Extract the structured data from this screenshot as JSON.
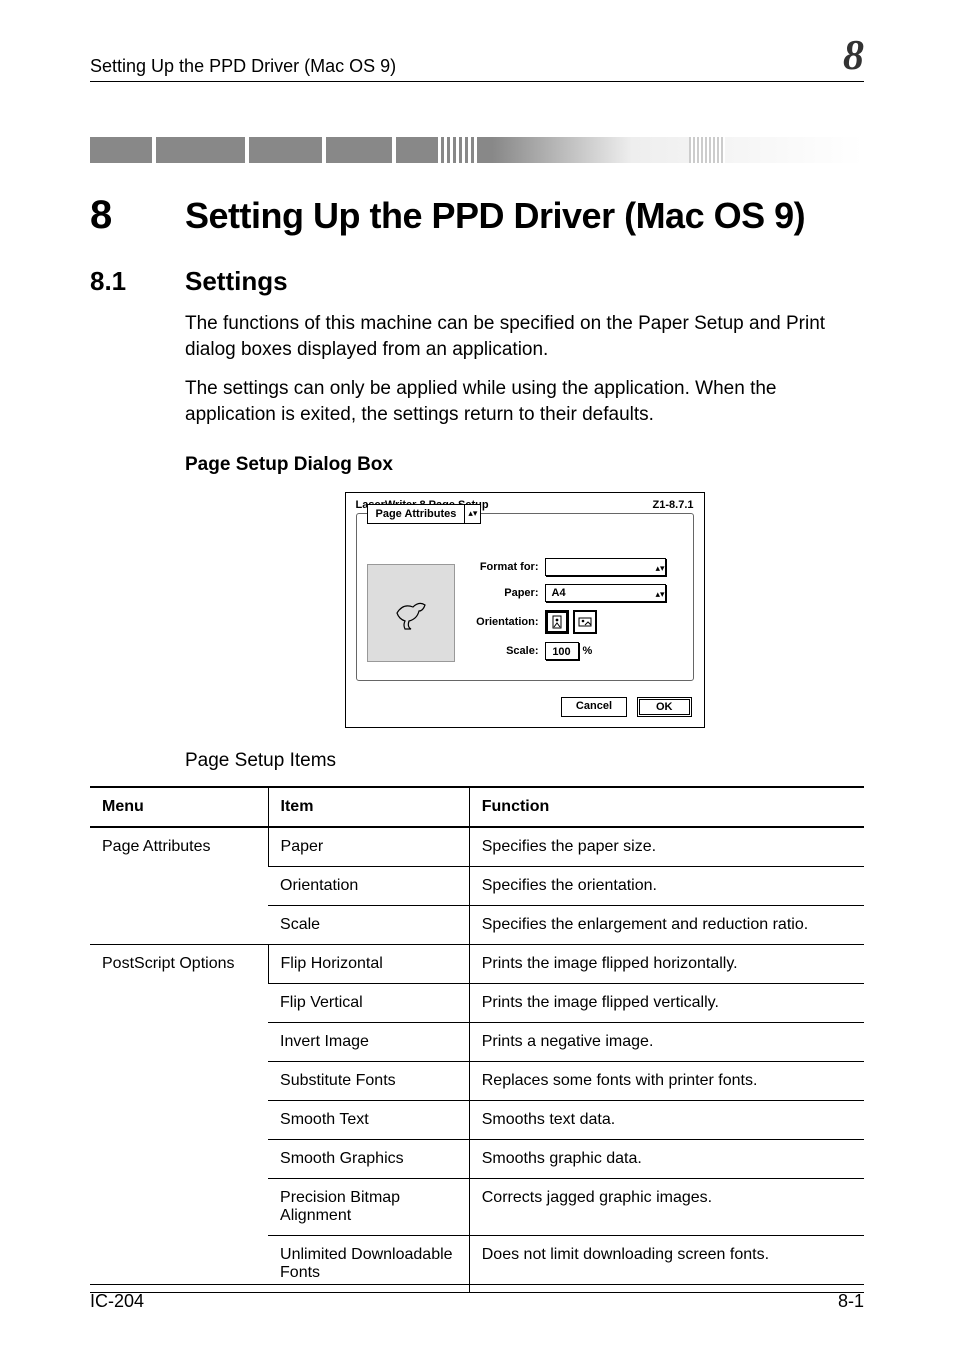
{
  "header": {
    "running_head": "Setting Up the PPD Driver (Mac OS 9)",
    "chapter_badge": "8"
  },
  "chapter": {
    "number": "8",
    "title": "Setting Up the PPD Driver (Mac OS 9)"
  },
  "section": {
    "number": "8.1",
    "title": "Settings"
  },
  "paragraphs": {
    "p1": "The functions of this machine can be specified on the Paper Setup and Print dialog boxes displayed from an application.",
    "p2": "The settings can only be applied while using the application. When the application is exited, the settings return to their defaults."
  },
  "dialog_heading": "Page Setup Dialog Box",
  "dialog": {
    "title": "LaserWriter 8 Page Setup",
    "version": "Z1-8.7.1",
    "panel_popup": "Page Attributes",
    "format_for_label": "Format for:",
    "format_for_value": " ",
    "paper_label": "Paper:",
    "paper_value": "A4",
    "orientation_label": "Orientation:",
    "scale_label": "Scale:",
    "scale_value": "100",
    "scale_unit": "%",
    "cancel": "Cancel",
    "ok": "OK"
  },
  "table_caption": "Page Setup Items",
  "table": {
    "headers": {
      "menu": "Menu",
      "item": "Item",
      "function": "Function"
    },
    "groups": [
      {
        "menu": "Page Attributes",
        "rows": [
          {
            "item": "Paper",
            "function": "Specifies the paper size."
          },
          {
            "item": "Orientation",
            "function": "Specifies the orientation."
          },
          {
            "item": "Scale",
            "function": "Specifies the enlargement and reduction ratio."
          }
        ]
      },
      {
        "menu": "PostScript Options",
        "rows": [
          {
            "item": "Flip Horizontal",
            "function": "Prints the image flipped horizontally."
          },
          {
            "item": "Flip Vertical",
            "function": "Prints the image flipped vertically."
          },
          {
            "item": "Invert Image",
            "function": "Prints a negative image."
          },
          {
            "item": "Substitute Fonts",
            "function": "Replaces some fonts with printer fonts."
          },
          {
            "item": "Smooth Text",
            "function": "Smooths text data."
          },
          {
            "item": "Smooth Graphics",
            "function": "Smooths graphic data."
          },
          {
            "item": "Precision Bitmap Alignment",
            "function": "Corrects jagged graphic images."
          },
          {
            "item": "Unlimited Downloadable Fonts",
            "function": "Does not limit downloading screen fonts."
          }
        ]
      }
    ]
  },
  "footer": {
    "left": "IC-204",
    "right": "8-1"
  }
}
